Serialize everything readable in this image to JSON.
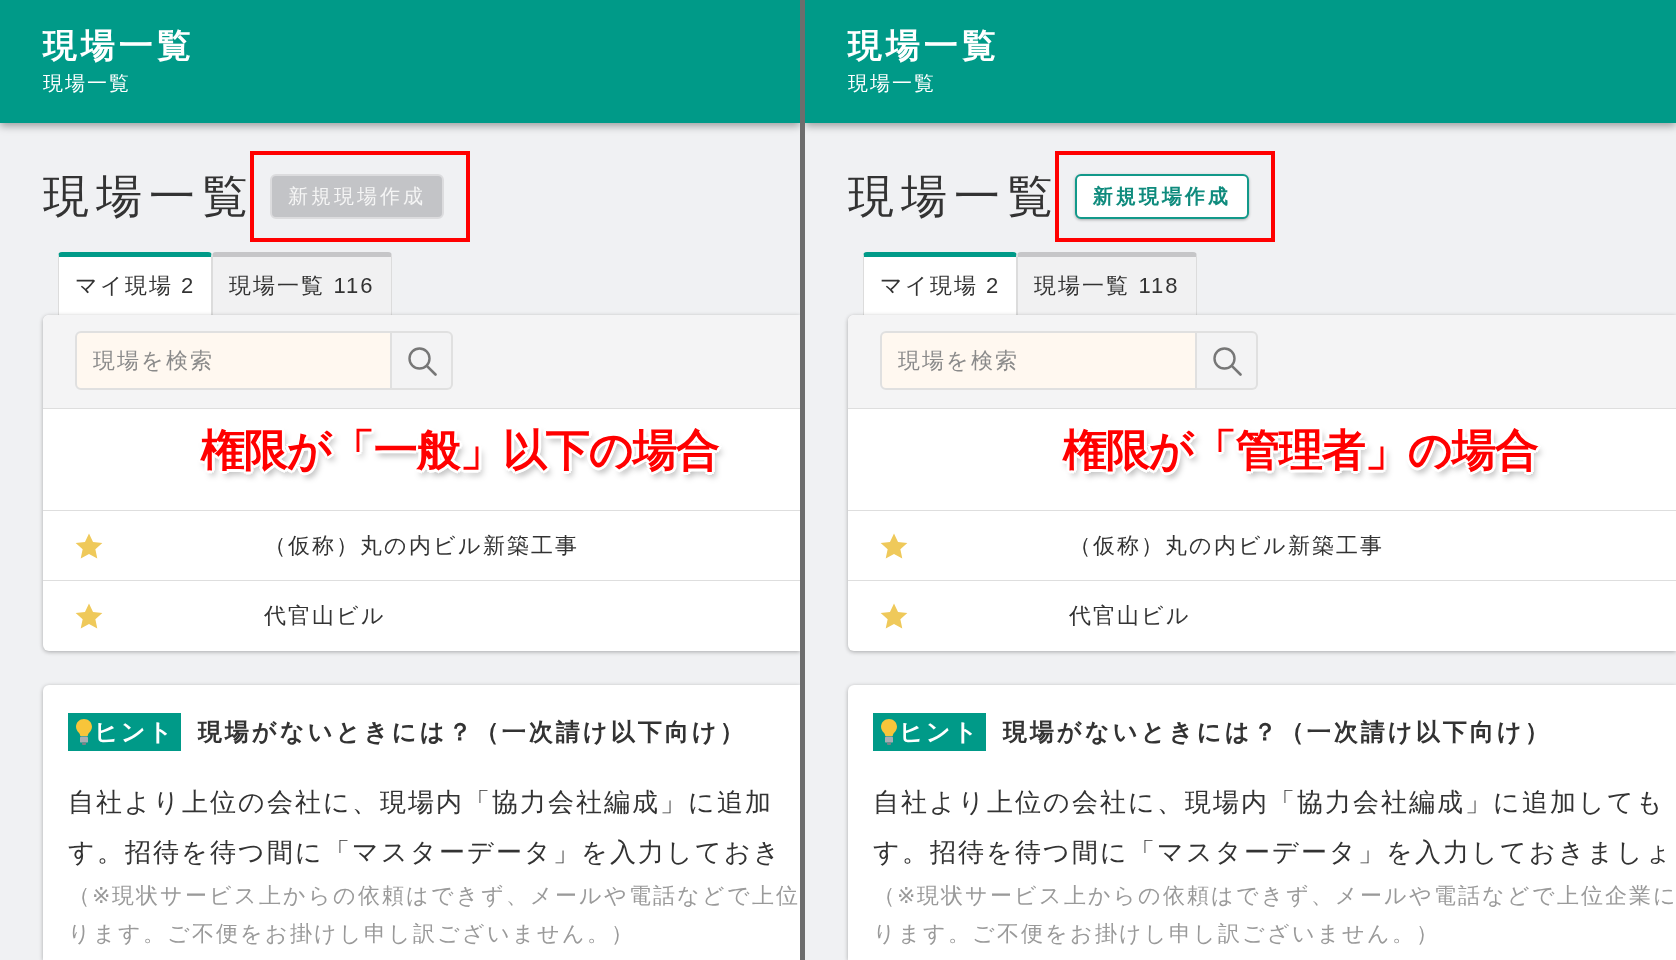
{
  "panels": [
    {
      "header": {
        "title": "現場一覧",
        "subtitle": "現場一覧"
      },
      "page_title": "現場一覧",
      "create_button": {
        "label": "新規現場作成",
        "disabled": true,
        "highlighted": true
      },
      "tabs": [
        {
          "label": "マイ現場 2",
          "selected": true
        },
        {
          "label": "現場一覧 116",
          "selected": false
        }
      ],
      "search": {
        "placeholder": "現場を検索"
      },
      "annotation": "権限が「一般」以下の場合",
      "sites": [
        {
          "name": "（仮称）丸の内ビル新築工事",
          "starred": true
        },
        {
          "name": "代官山ビル",
          "starred": true
        }
      ],
      "hint": {
        "badge": "ヒント",
        "title": "現場がないときには？（一次請け以下向け）",
        "body_lines": [
          "自社より上位の会社に、現場内「協力会社編成」に追加",
          "す。招待を待つ間に「マスターデータ」を入力しておき"
        ],
        "note_lines": [
          "（※現状サービス上からの依頼はできず、メールや電話などで上位",
          "ります。ご不便をお掛けし申し訳ございません。）"
        ]
      }
    },
    {
      "header": {
        "title": "現場一覧",
        "subtitle": "現場一覧"
      },
      "page_title": "現場一覧",
      "create_button": {
        "label": "新規現場作成",
        "disabled": false,
        "highlighted": true
      },
      "tabs": [
        {
          "label": "マイ現場 2",
          "selected": true
        },
        {
          "label": "現場一覧 118",
          "selected": false
        }
      ],
      "search": {
        "placeholder": "現場を検索"
      },
      "annotation": "権限が「管理者」の場合",
      "sites": [
        {
          "name": "（仮称）丸の内ビル新築工事",
          "starred": true
        },
        {
          "name": "代官山ビル",
          "starred": true
        }
      ],
      "hint": {
        "badge": "ヒント",
        "title": "現場がないときには？（一次請け以下向け）",
        "body_lines": [
          "自社より上位の会社に、現場内「協力会社編成」に追加しても",
          "す。招待を待つ間に「マスターデータ」を入力しておきましょ"
        ],
        "note_lines": [
          "（※現状サービス上からの依頼はできず、メールや電話などで上位企業に",
          "ります。ご不便をお掛けし申し訳ございません。）"
        ]
      }
    }
  ]
}
